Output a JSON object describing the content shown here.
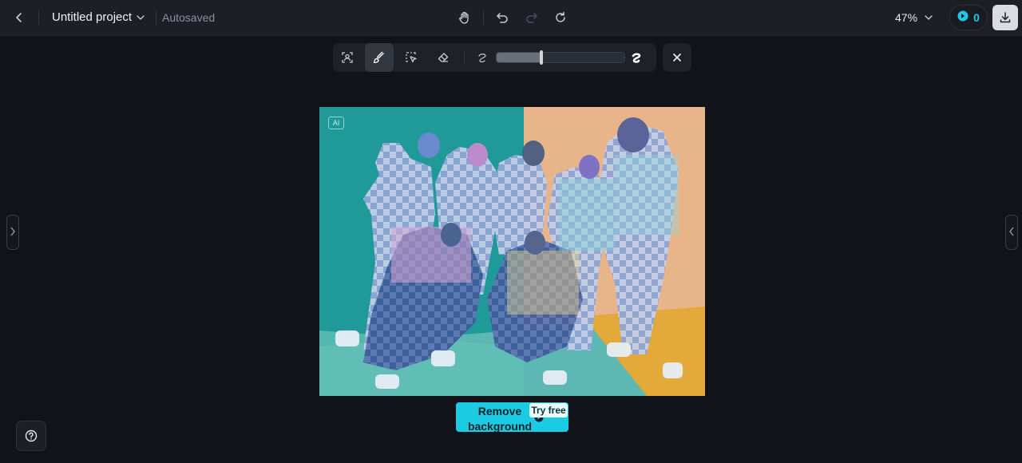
{
  "header": {
    "project_title": "Untitled project",
    "save_status": "Autosaved",
    "zoom": "47%",
    "credits": "0"
  },
  "toolbar": {
    "tools": [
      "portrait-select",
      "brush",
      "region-select",
      "eraser"
    ],
    "active_tool": "brush",
    "brush_size_fraction": 0.35
  },
  "canvas": {
    "ai_badge": "AI"
  },
  "actions": {
    "remove_background_label": "Remove background",
    "try_free_badge": "Try free"
  },
  "colors": {
    "accent": "#1bcbe3",
    "background": "#111318",
    "topbar": "#1c1f25"
  }
}
